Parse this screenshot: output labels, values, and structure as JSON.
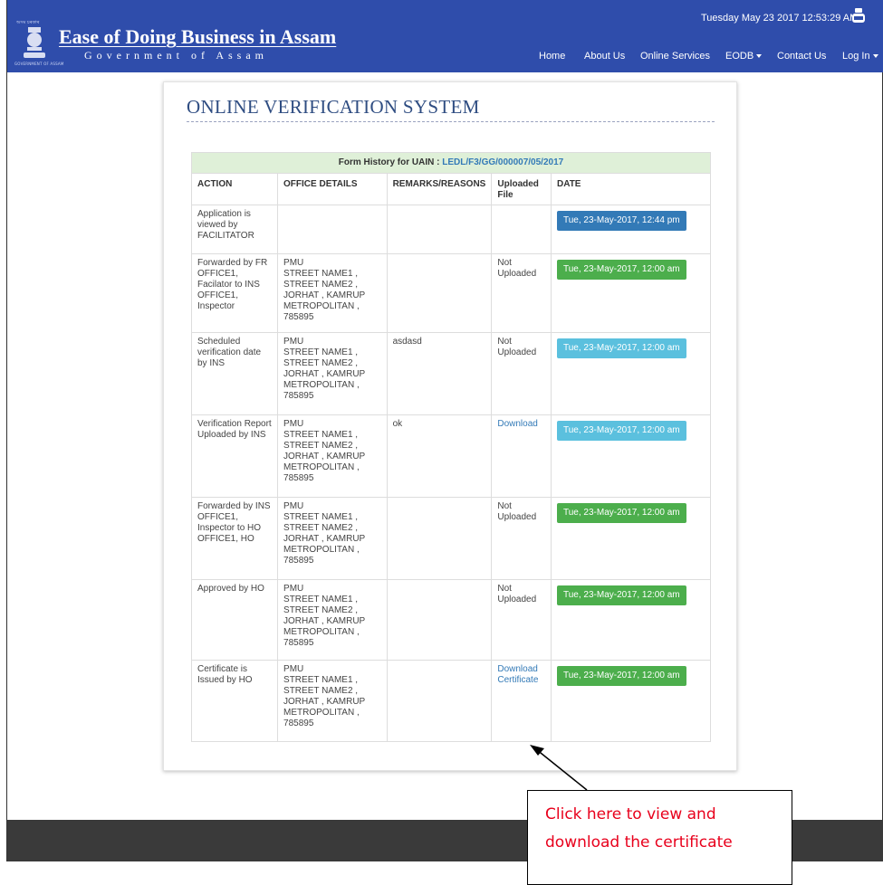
{
  "header": {
    "emblem_caption": "অসম চৰকাৰ",
    "emblem_footer": "GOVERNMENT OF ASSAM",
    "title": "Ease of Doing Business in Assam",
    "subtitle": "Government of Assam",
    "datetime": "Tuesday May 23 2017 12:53:29 AM",
    "youtube_icon": "youtube-icon",
    "nav": {
      "home": "Home",
      "about": "About Us",
      "services": "Online Services",
      "eodb": "EODB",
      "contact": "Contact Us",
      "login": "Log In"
    },
    "colors": {
      "bar": "#2f4dab"
    }
  },
  "page": {
    "title": "ONLINE VERIFICATION SYSTEM",
    "history_label": "Form History for UAIN : ",
    "uain": "LEDL/F3/GG/000007/05/2017"
  },
  "table": {
    "columns": {
      "action": "ACTION",
      "office": "OFFICE DETAILS",
      "remarks": "REMARKS/REASONS",
      "file": "Uploaded File",
      "date": "DATE"
    },
    "office_block": {
      "l1": "PMU",
      "l2": "STREET NAME1 ,",
      "l3": "STREET NAME2 ,",
      "l4": "JORHAT , KAMRUP",
      "l5": "METROPOLITAN ,",
      "l6": "785895"
    },
    "rows": [
      {
        "action": "Application is viewed by FACILITATOR",
        "remarks": "",
        "file": "",
        "date": "Tue, 23-May-2017, 12:44 pm"
      },
      {
        "action": "Forwarded by FR OFFICE1, Facilator to INS OFFICE1, Inspector",
        "remarks": "",
        "file": "Not Uploaded",
        "date": "Tue, 23-May-2017, 12:00 am"
      },
      {
        "action": "Scheduled verification date by INS",
        "remarks": "asdasd",
        "file": "Not Uploaded",
        "date": "Tue, 23-May-2017, 12:00 am"
      },
      {
        "action": "Verification Report Uploaded by INS",
        "remarks": "ok",
        "file": "Download",
        "date": "Tue, 23-May-2017, 12:00 am"
      },
      {
        "action": "Forwarded by INS OFFICE1, Inspector to HO OFFICE1, HO",
        "remarks": "",
        "file": "Not Uploaded",
        "date": "Tue, 23-May-2017, 12:00 am"
      },
      {
        "action": "Approved by HO",
        "remarks": "",
        "file": "Not Uploaded",
        "date": "Tue, 23-May-2017, 12:00 am"
      },
      {
        "action": "Certificate is Issued by HO",
        "remarks": "",
        "file": "Download Certificate",
        "date": "Tue, 23-May-2017, 12:00 am"
      }
    ],
    "colors": {
      "primary": "#337ab7",
      "success": "#4cae4c",
      "info": "#5bc0de",
      "caption_bg": "#dff0d8"
    }
  },
  "annotation": {
    "text": "Click here to view and download the certificate"
  }
}
